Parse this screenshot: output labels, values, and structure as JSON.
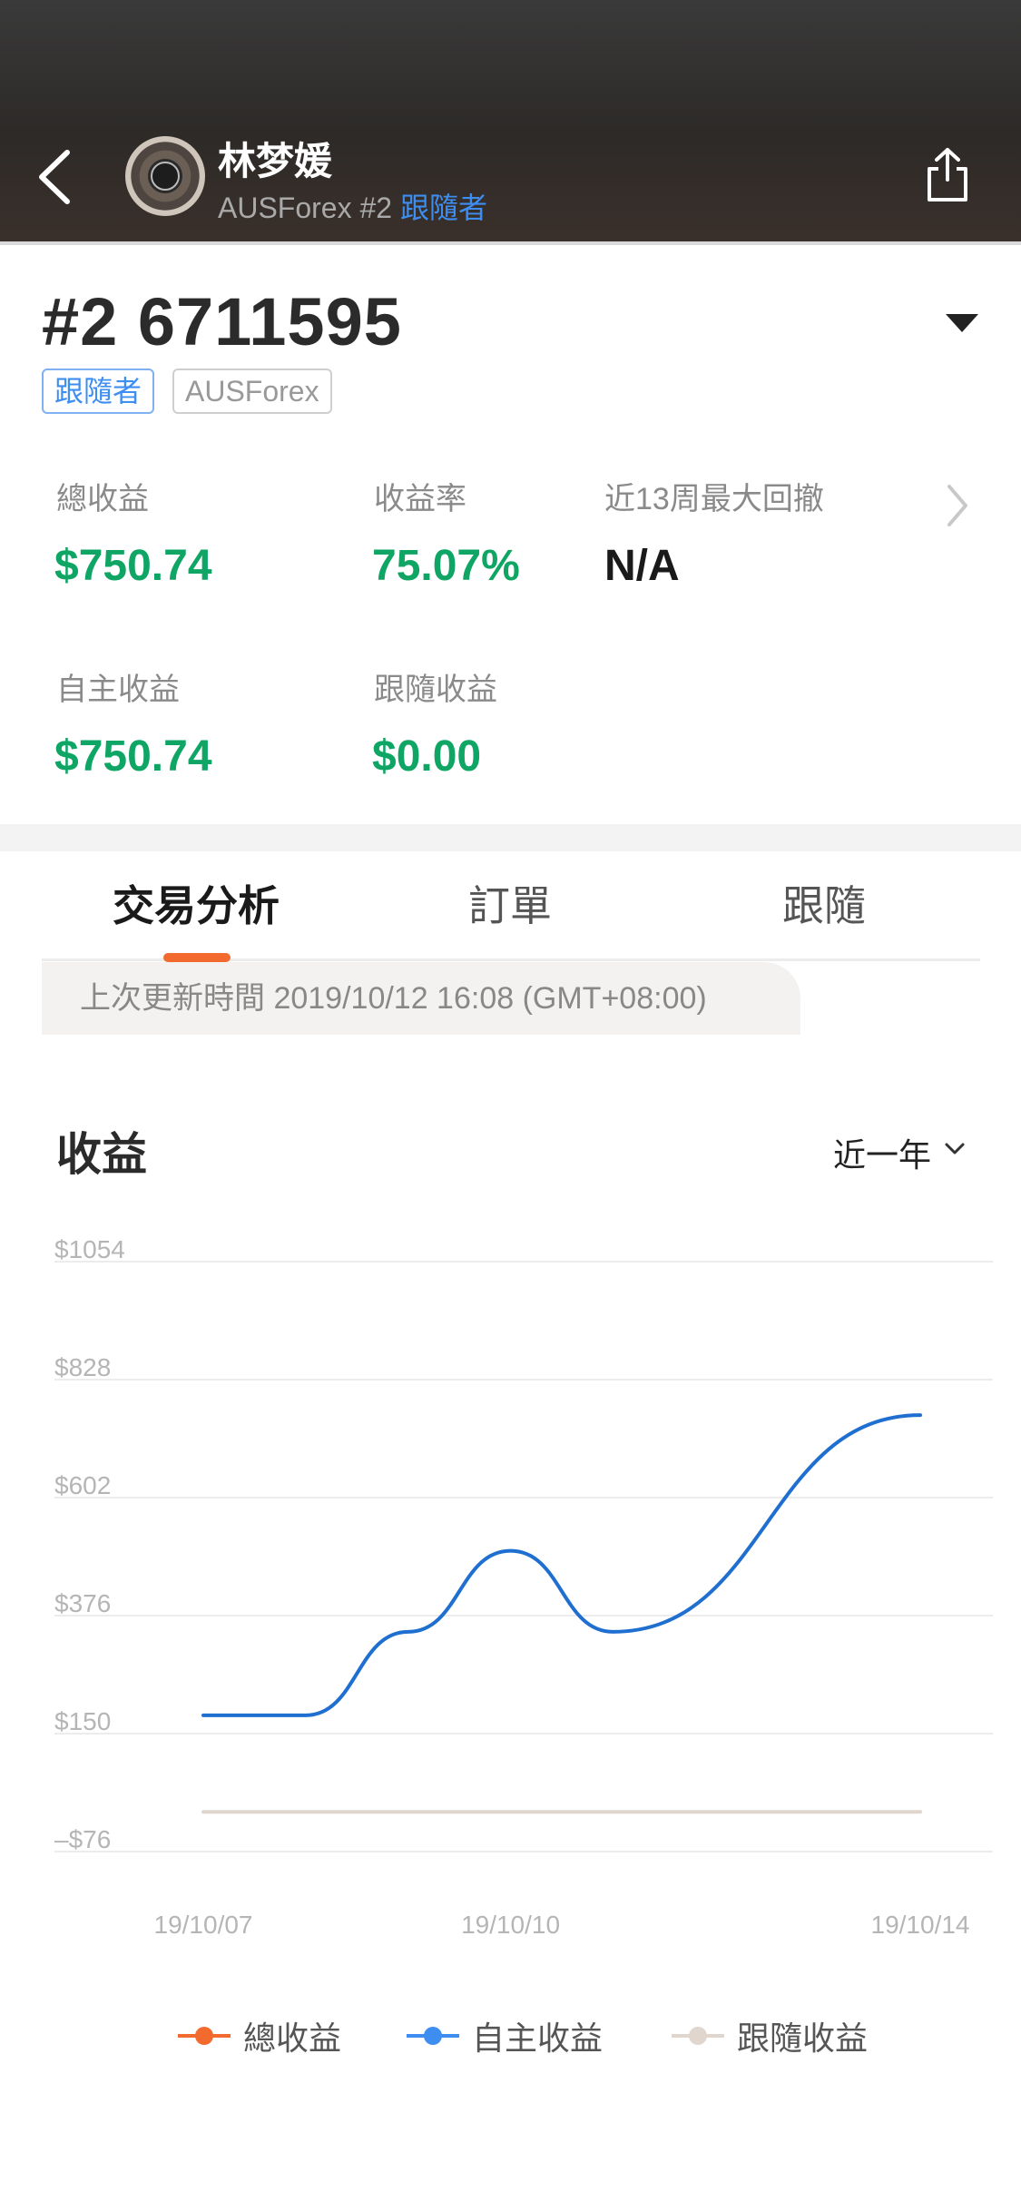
{
  "header": {
    "name": "林梦媛",
    "broker": "AUSForex",
    "account_no": "#2",
    "role": "跟隨者"
  },
  "account": {
    "title": "#2 6711595",
    "tags": [
      "跟隨者",
      "AUSForex"
    ]
  },
  "stats": {
    "total_label": "總收益",
    "total_value": "$750.74",
    "rate_label": "收益率",
    "rate_value": "75.07%",
    "drawdown_label": "近13周最大回撤",
    "drawdown_value": "N/A",
    "self_label": "自主收益",
    "self_value": "$750.74",
    "follow_label": "跟隨收益",
    "follow_value": "$0.00"
  },
  "tabs": [
    "交易分析",
    "訂單",
    "跟隨"
  ],
  "update_text": "上次更新時間 2019/10/12 16:08 (GMT+08:00)",
  "chart_section": {
    "title": "收益",
    "range": "近一年"
  },
  "colors": {
    "accent": "#f26a2e",
    "profit_green": "#0fa564",
    "link_blue": "#3d8ef0",
    "self_line": "#1f6fd1",
    "follow_line": "#e0d6cd"
  },
  "chart_data": {
    "type": "line",
    "x_ticks": [
      "19/10/07",
      "19/10/10",
      "19/10/14"
    ],
    "y_ticks": [
      "$1054",
      "$828",
      "$602",
      "$376",
      "$150",
      "–$76"
    ],
    "ylim": [
      -76,
      1054
    ],
    "series": [
      {
        "name": "總收益",
        "color": "#f26a2e",
        "values": []
      },
      {
        "name": "自主收益",
        "color": "#1f6fd1",
        "x": [
          "19/10/07",
          "19/10/08",
          "19/10/09",
          "19/10/10",
          "19/10/11",
          "19/10/14"
        ],
        "values": [
          185,
          185,
          345,
          500,
          345,
          760
        ]
      },
      {
        "name": "跟隨收益",
        "color": "#e0d6cd",
        "x": [
          "19/10/07",
          "19/10/14"
        ],
        "values": [
          0,
          0
        ]
      }
    ],
    "grid": true,
    "legend_position": "bottom"
  }
}
